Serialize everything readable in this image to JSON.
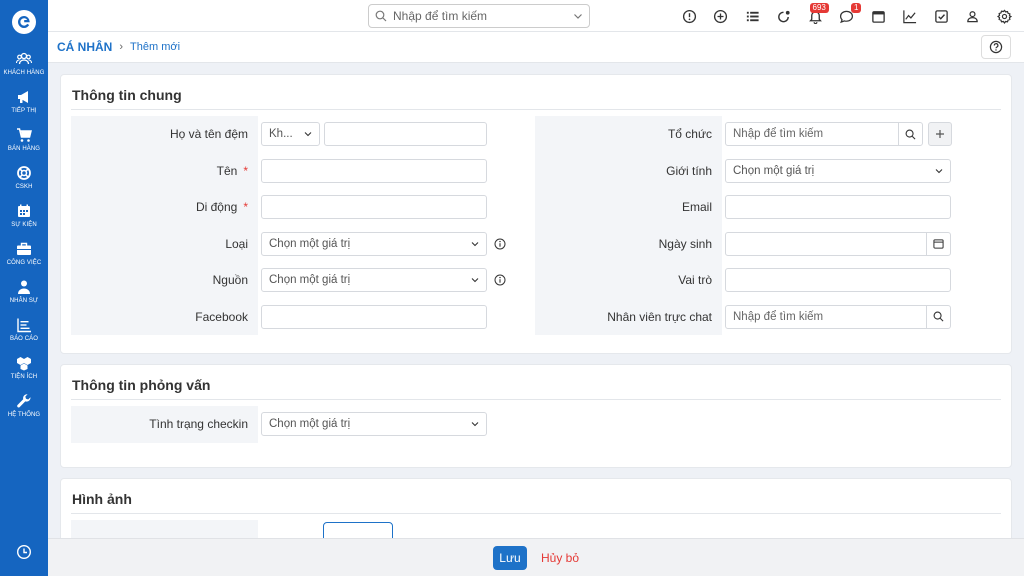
{
  "sidebar": {
    "items": [
      {
        "label": "Khách hàng",
        "icon": "users-icon"
      },
      {
        "label": "Tiếp thị",
        "icon": "megaphone-icon"
      },
      {
        "label": "Bán hàng",
        "icon": "cart-icon"
      },
      {
        "label": "CSKH",
        "icon": "lifebuoy-icon"
      },
      {
        "label": "Sự kiện",
        "icon": "calendar-icon"
      },
      {
        "label": "Công việc",
        "icon": "briefcase-icon"
      },
      {
        "label": "Nhân sự",
        "icon": "person-icon"
      },
      {
        "label": "Báo cáo",
        "icon": "chart-icon"
      },
      {
        "label": "Tiện ích",
        "icon": "boxes-icon"
      },
      {
        "label": "Hệ thống",
        "icon": "wrench-icon"
      }
    ]
  },
  "topbar": {
    "search_placeholder": "Nhập để tìm kiếm",
    "notification_count": "693",
    "chat_count": "1"
  },
  "breadcrumb": {
    "main": "CÁ NHÂN",
    "sub": "Thêm mới"
  },
  "section_general": {
    "title": "Thông tin chung",
    "left": {
      "fullname_label": "Họ và tên đệm",
      "title_select": "Kh...",
      "name_label": "Tên",
      "mobile_label": "Di động",
      "type_label": "Loại",
      "type_value": "Chọn một giá trị",
      "source_label": "Nguồn",
      "source_value": "Chọn một giá trị",
      "facebook_label": "Facebook"
    },
    "right": {
      "org_label": "Tổ chức",
      "org_placeholder": "Nhập để tìm kiếm",
      "gender_label": "Giới tính",
      "gender_value": "Chọn một giá trị",
      "email_label": "Email",
      "birthday_label": "Ngày sinh",
      "role_label": "Vai trò",
      "chat_staff_label": "Nhân viên trực chat",
      "chat_staff_placeholder": "Nhập để tìm kiếm"
    }
  },
  "section_interview": {
    "title": "Thông tin phỏng vấn",
    "checkin_label": "Tình trạng checkin",
    "checkin_value": "Chọn một giá trị"
  },
  "section_image": {
    "title": "Hình ảnh"
  },
  "footer": {
    "save_label": "Lưu",
    "cancel_label": "Hủy bỏ"
  },
  "colors": {
    "brand": "#1565c0",
    "accent": "#1e72c8",
    "danger": "#e53935"
  }
}
